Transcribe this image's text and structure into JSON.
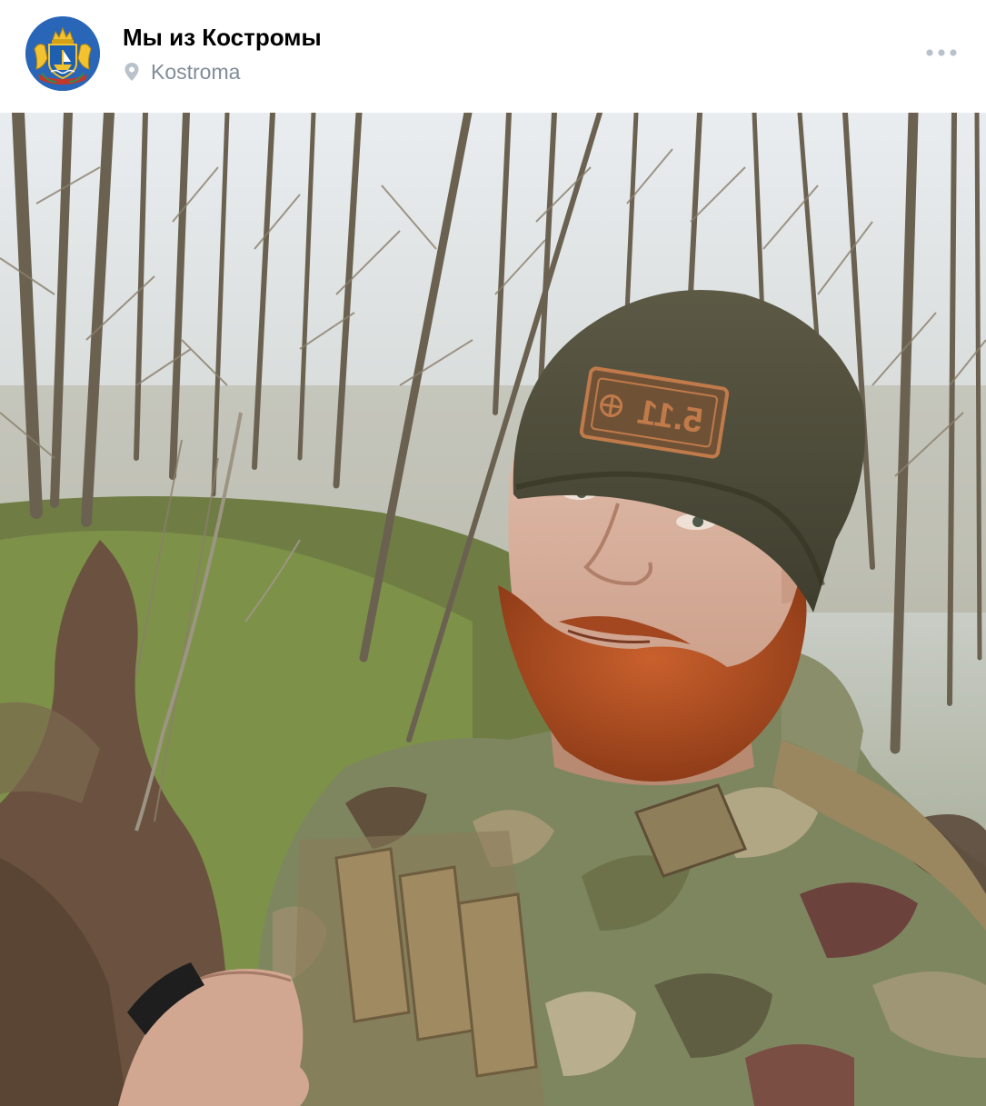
{
  "post": {
    "author": "Мы из Костромы",
    "location": "Kostroma",
    "avatar_icon": "kostroma-coat-of-arms",
    "menu_icon": "more-horizontal-icon"
  },
  "photo": {
    "cap_badge": "5.11"
  },
  "colors": {
    "title": "#000000",
    "secondary_text": "#818c99",
    "icon_gray": "#b8c1cc",
    "avatar_blue": "#2a66b8"
  }
}
